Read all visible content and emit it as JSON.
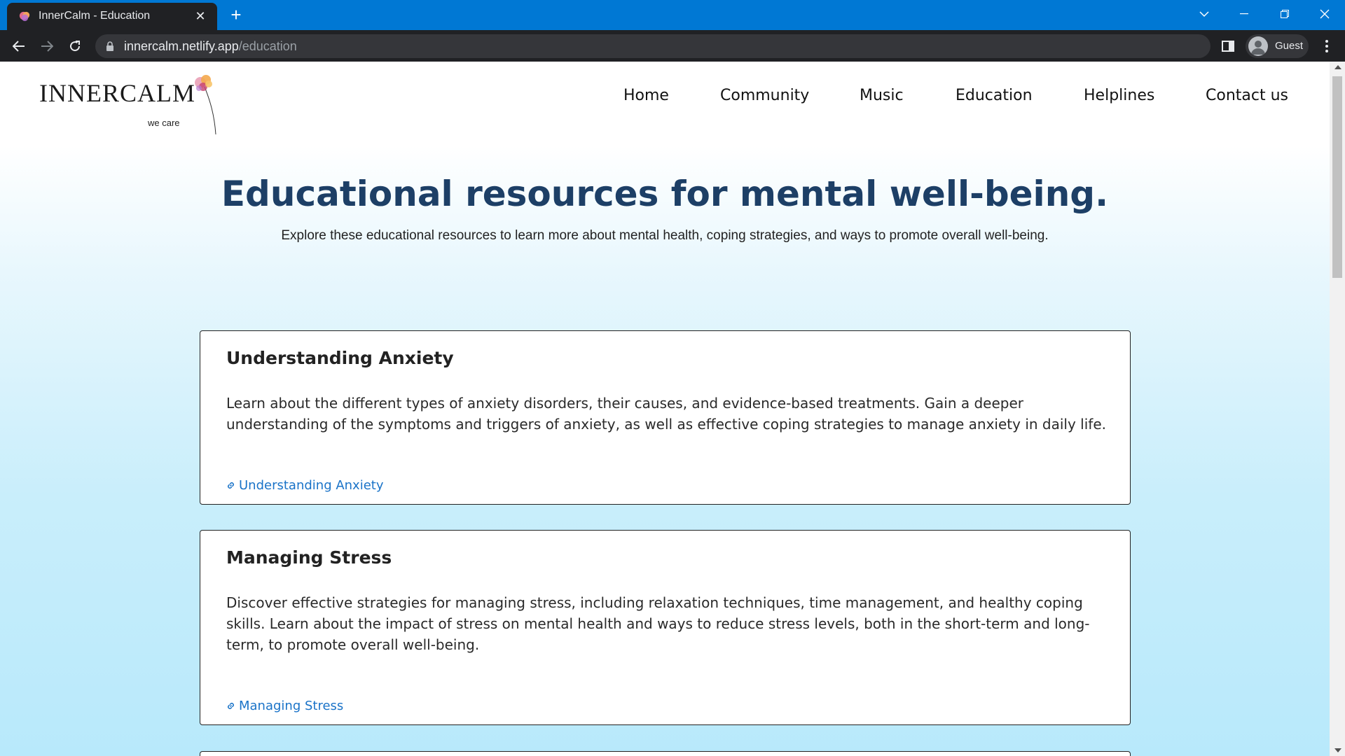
{
  "browser": {
    "tab_title": "InnerCalm - Education",
    "url_host": "innercalm.netlify.app",
    "url_path": "/education",
    "profile_label": "Guest",
    "tab_bar_color": "#0078d4"
  },
  "site": {
    "logo_word": "INNERCALM",
    "logo_tagline": "we care",
    "nav": [
      "Home",
      "Community",
      "Music",
      "Education",
      "Helplines",
      "Contact us"
    ]
  },
  "hero": {
    "title": "Educational resources for mental well-being.",
    "subtitle": "Explore these educational resources to learn more about mental health, coping strategies, and ways to promote overall well-being."
  },
  "cards": [
    {
      "title": "Understanding Anxiety",
      "body": "Learn about the different types of anxiety disorders, their causes, and evidence-based treatments. Gain a deeper understanding of the symptoms and triggers of anxiety, as well as effective coping strategies to manage anxiety in daily life.",
      "link_label": "Understanding Anxiety"
    },
    {
      "title": "Managing Stress",
      "body": "Discover effective strategies for managing stress, including relaxation techniques, time management, and healthy coping skills. Learn about the impact of stress on mental health and ways to reduce stress levels, both in the short-term and long-term, to promote overall well-being.",
      "link_label": "Managing Stress"
    }
  ],
  "colors": {
    "title_navy": "#1d3f66",
    "link_blue": "#1a73c8"
  }
}
